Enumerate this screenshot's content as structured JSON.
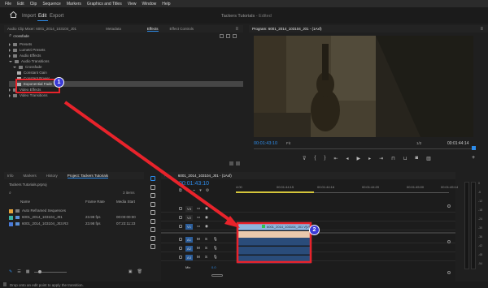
{
  "menu": [
    "File",
    "Edit",
    "Clip",
    "Sequence",
    "Markers",
    "Graphics and Titles",
    "View",
    "Window",
    "Help"
  ],
  "workspace": {
    "tabs": [
      "Import",
      "Edit",
      "Export"
    ],
    "active": "Edit",
    "project_title": "Tackers Tutorials",
    "project_state": "- Edited"
  },
  "effects_panel": {
    "tabs": [
      "Audio Clip Mixer: 6001_2014_103104_J01",
      "Metadata",
      "Effects",
      "Effect Controls"
    ],
    "active_tab": "Effects",
    "search_value": "crossfade",
    "tree": [
      {
        "label": "Presets",
        "depth": 0,
        "expanded": false
      },
      {
        "label": "Lumetri Presets",
        "depth": 0,
        "expanded": false
      },
      {
        "label": "Audio Effects",
        "depth": 0,
        "expanded": false
      },
      {
        "label": "Audio Transitions",
        "depth": 0,
        "expanded": true
      },
      {
        "label": "Crossfade",
        "depth": 1,
        "expanded": true
      },
      {
        "label": "Constant Gain",
        "depth": 2,
        "item": true
      },
      {
        "label": "Constant Power",
        "depth": 2,
        "item": true
      },
      {
        "label": "Exponential Fade",
        "depth": 2,
        "item": true,
        "selected": true
      },
      {
        "label": "Video Effects",
        "depth": 0,
        "expanded": false
      },
      {
        "label": "Video Transitions",
        "depth": 0,
        "expanded": false
      }
    ]
  },
  "program_monitor": {
    "title": "Program: 6001_2014_103104_J01 - (1Axf)",
    "timecode": "00:01:43:10",
    "fit": "Fit",
    "resolution": "1/2",
    "duration": "00:01:44:14"
  },
  "project_panel": {
    "tabs": [
      "Info",
      "Markers",
      "History",
      "Project: Tackers Tutorials"
    ],
    "active_tab": "Project: Tackers Tutorials",
    "file": "Tackers Tutorials.prproj",
    "items_count": "3 items",
    "columns": [
      "Name",
      "Frame Rate",
      "Media Start"
    ],
    "rows": [
      {
        "name": "Auto Reframed Sequences",
        "rate": "",
        "start": "",
        "color": "#e5a33b"
      },
      {
        "name": "6001_2014_103104_J01",
        "rate": "23.98 fps",
        "start": "00:00:00:00",
        "color": "#3bb5a6"
      },
      {
        "name": "6001_2014_103104_J03.R3",
        "rate": "23.98 fps",
        "start": "07:23:11:23",
        "color": "#4a7bd8"
      }
    ]
  },
  "timeline": {
    "tab": "6001_2014_103104_J01 - (1Axf)",
    "timecode": "00:01:43:10",
    "ruler": [
      "4:00",
      "00:01:44:15",
      "00:01:44:16",
      "00:01:44:20",
      "00:01:45:00",
      "00:01:45:14"
    ],
    "video_tracks": [
      "V3",
      "V2",
      "V1"
    ],
    "audio_tracks": [
      "A1",
      "A2",
      "A3"
    ],
    "mix_label": "Mix",
    "mix_value": "0.0",
    "clip_label": "6001_2014_103104_J01 V[V]"
  },
  "annotations": {
    "badge1": "1",
    "badge2": "2"
  },
  "meter_ticks": [
    "0",
    "-6",
    "-12",
    "-18",
    "-24",
    "-30",
    "-36",
    "-42",
    "-48",
    "-54"
  ],
  "status": "Drop onto an edit point to apply the transition.",
  "colors": {
    "accent": "#2d8ceb",
    "callout": "#e8232b",
    "clip_video": "#8fb5dc",
    "clip_audio_sel": "#2a4c7a"
  }
}
